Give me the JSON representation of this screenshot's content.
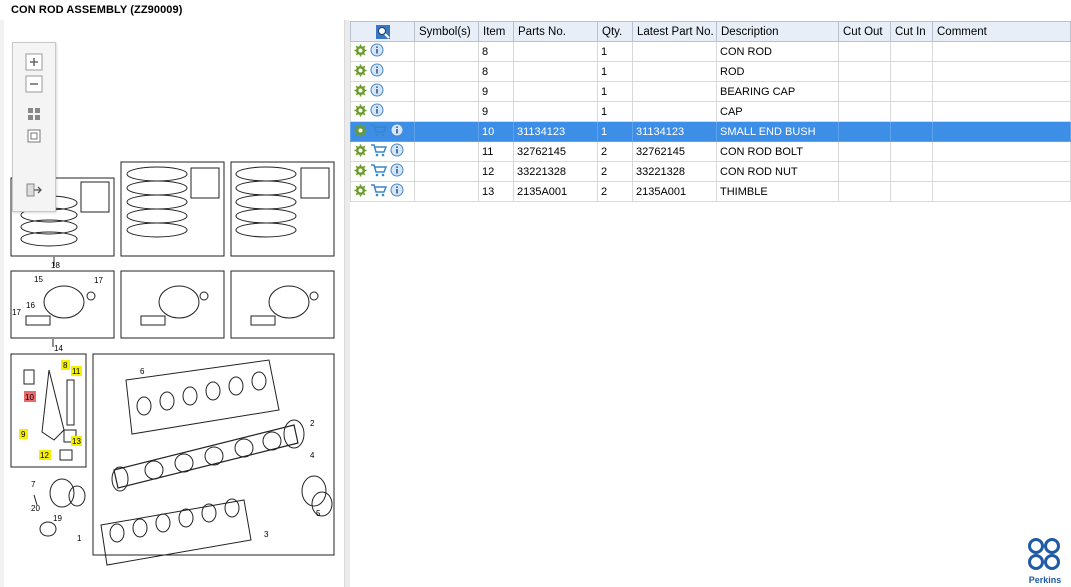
{
  "title": "CON ROD ASSEMBLY (ZZ90009)",
  "columns": [
    "",
    "Symbol(s)",
    "Item",
    "Parts No.",
    "Qty.",
    "Latest Part No.",
    "Description",
    "Cut Out",
    "Cut In",
    "Comment"
  ],
  "rows": [
    {
      "item": "8",
      "parts_no": "",
      "qty": "1",
      "latest": "",
      "desc": "CON ROD",
      "cart": false,
      "selected": false
    },
    {
      "item": "8",
      "parts_no": "",
      "qty": "1",
      "latest": "",
      "desc": "ROD",
      "cart": false,
      "selected": false
    },
    {
      "item": "9",
      "parts_no": "",
      "qty": "1",
      "latest": "",
      "desc": "BEARING CAP",
      "cart": false,
      "selected": false
    },
    {
      "item": "9",
      "parts_no": "",
      "qty": "1",
      "latest": "",
      "desc": "CAP",
      "cart": false,
      "selected": false
    },
    {
      "item": "10",
      "parts_no": "31134123",
      "qty": "1",
      "latest": "31134123",
      "desc": "SMALL END BUSH",
      "cart": true,
      "selected": true
    },
    {
      "item": "11",
      "parts_no": "32762145",
      "qty": "2",
      "latest": "32762145",
      "desc": "CON ROD BOLT",
      "cart": true,
      "selected": false
    },
    {
      "item": "12",
      "parts_no": "33221328",
      "qty": "2",
      "latest": "33221328",
      "desc": "CON ROD NUT",
      "cart": true,
      "selected": false
    },
    {
      "item": "13",
      "parts_no": "2135A001",
      "qty": "2",
      "latest": "2135A001",
      "desc": "THIMBLE",
      "cart": true,
      "selected": false
    }
  ],
  "diagram_callouts": [
    "18",
    "15",
    "17",
    "16",
    "17",
    "14",
    "8",
    "11",
    "10",
    "9",
    "13",
    "12",
    "6",
    "2",
    "4",
    "5",
    "7",
    "20",
    "19",
    "1",
    "3"
  ],
  "brand": "Perkins",
  "colors": {
    "selected": "#3d8ee6",
    "header": "#e8eef7",
    "highlight_yellow": "#f5f000",
    "highlight_red": "#e86a6a",
    "logo_blue": "#1f5aa6"
  }
}
